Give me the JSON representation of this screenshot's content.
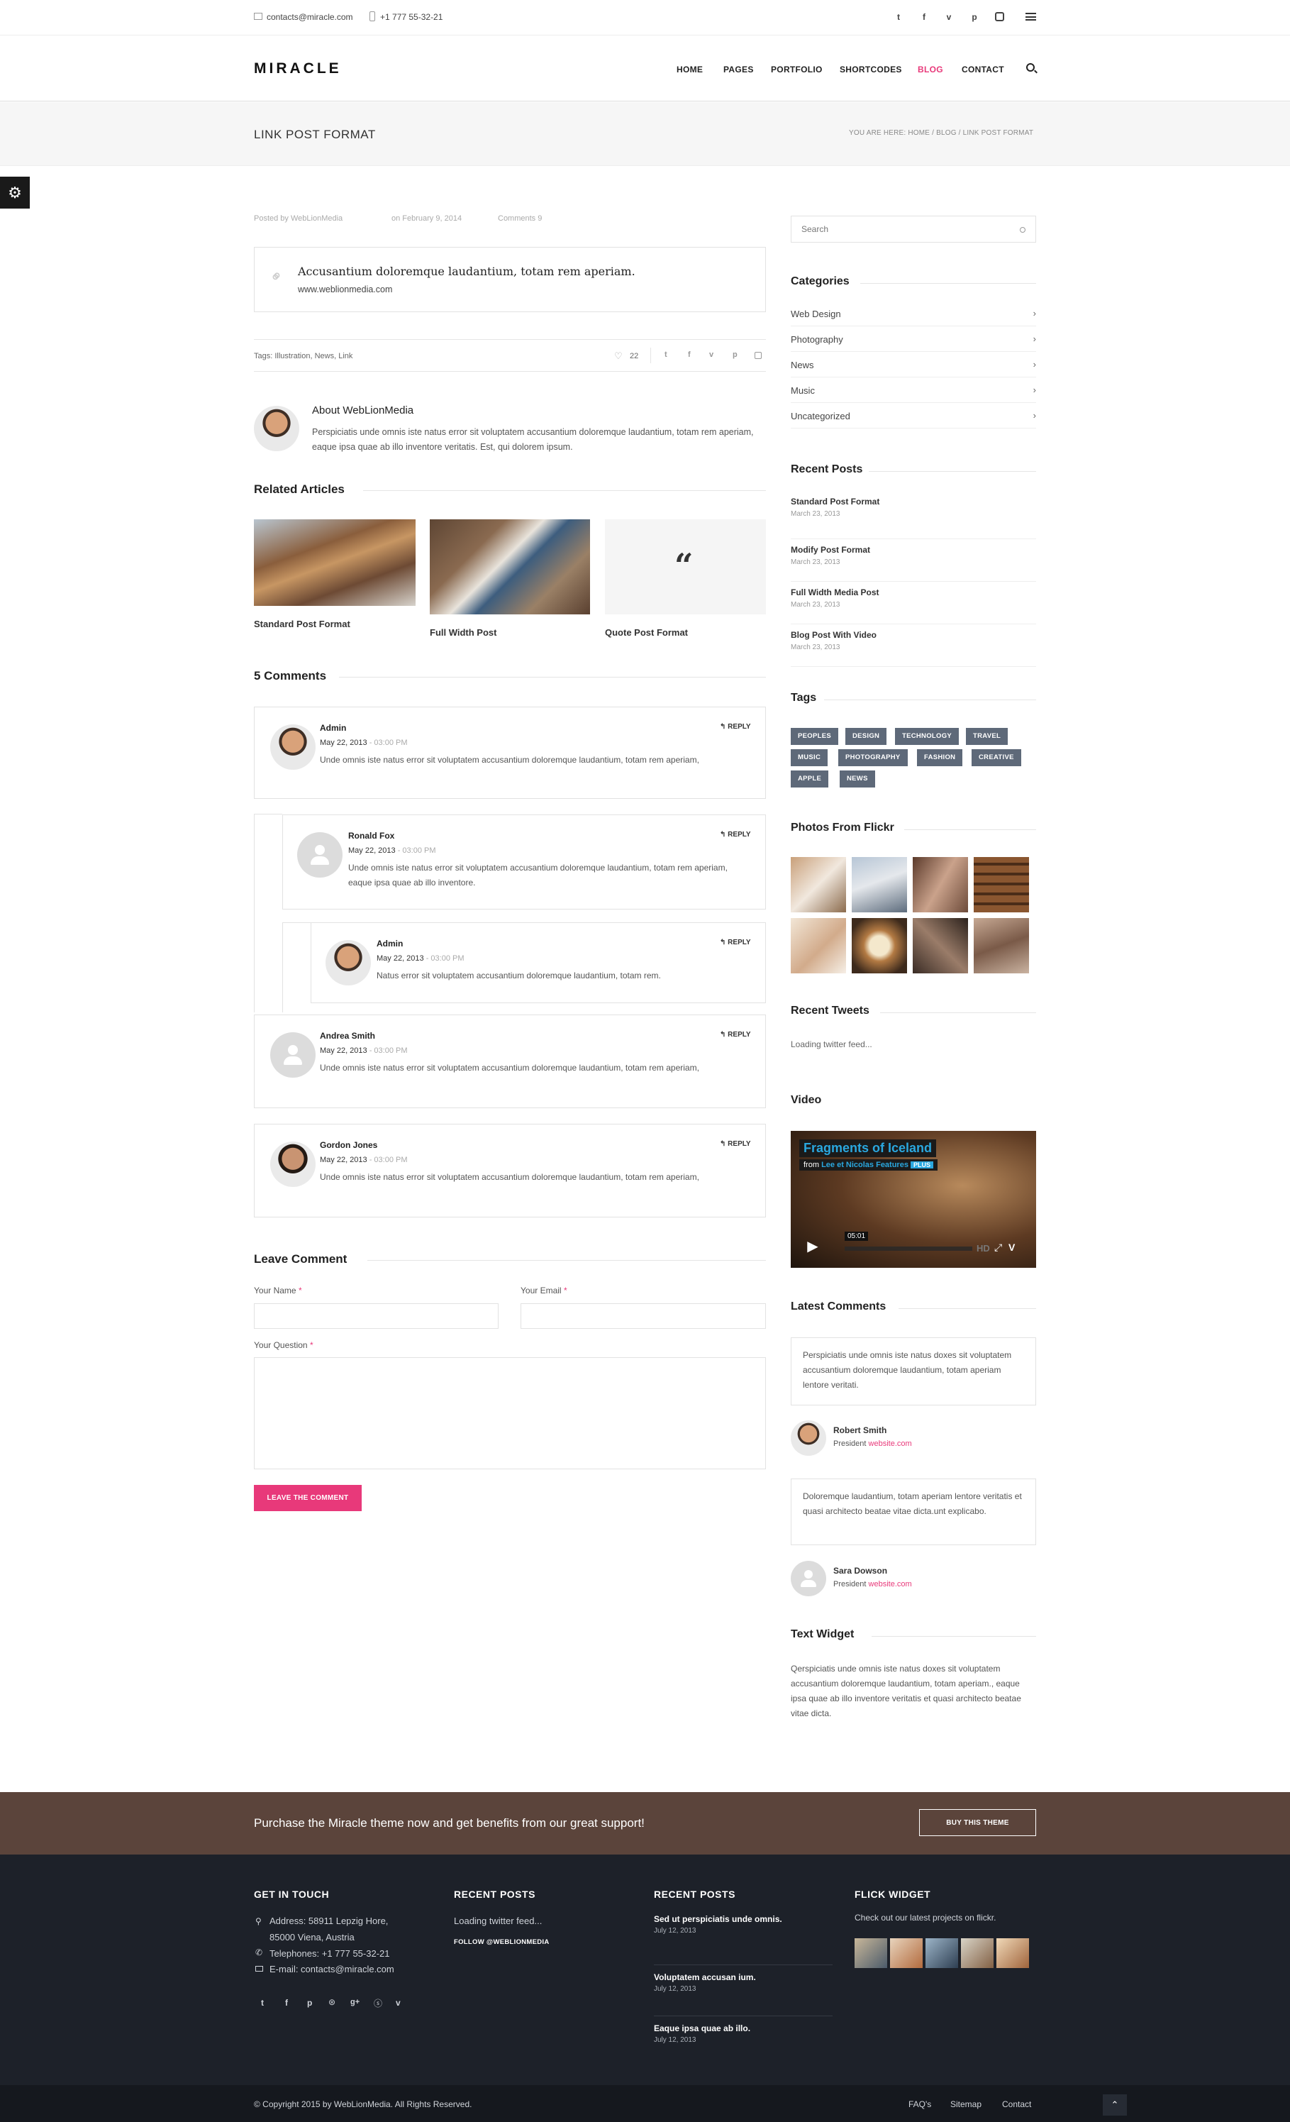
{
  "topbar": {
    "email": "contacts@miracle.com",
    "phone": "+1 777 55-32-21",
    "social": [
      "twitter-icon",
      "facebook-icon",
      "vimeo-icon",
      "pinterest-icon",
      "instagram-icon"
    ]
  },
  "header": {
    "logo": "MIRACLE",
    "nav": [
      "HOME",
      "PAGES",
      "PORTFOLIO",
      "SHORTCODES",
      "BLOG",
      "CONTACT"
    ],
    "active_nav": "BLOG",
    "accent": "#e8397a"
  },
  "titlebar": {
    "title": "LINK POST FORMAT",
    "breadcrumb": "YOU ARE HERE: HOME / BLOG / LINK POST FORMAT"
  },
  "post": {
    "posted_by": "Posted by WebLionMedia",
    "date": "on February 9, 2014",
    "comments": "Comments 9",
    "link_title": "Accusantium doloremque laudantium, totam rem aperiam.",
    "link_url": "www.weblionmedia.com",
    "tags": "Tags: Illustration, News, Link",
    "likes": "22"
  },
  "author": {
    "title": "About WebLionMedia",
    "bio": "Perspiciatis unde omnis iste natus error sit voluptatem accusantium doloremque laudantium, totam rem aperiam, eaque ipsa quae ab illo inventore veritatis. Est, qui dolorem ipsum."
  },
  "related": {
    "title": "Related Articles",
    "items": [
      "Standard Post Format",
      "Full Width Post",
      "Quote Post Format"
    ]
  },
  "comments": {
    "title": "5 Comments",
    "reply_label": "REPLY",
    "list": [
      {
        "name": "Admin",
        "date": "May 22, 2013",
        "time": " - 03:00 PM",
        "text": "Unde omnis iste natus error sit voluptatem accusantium doloremque laudantium, totam rem aperiam,"
      },
      {
        "name": "Ronald Fox",
        "date": "May 22, 2013",
        "time": " - 03:00 PM",
        "text": "Unde omnis iste natus error sit voluptatem accusantium doloremque laudantium, totam rem aperiam, eaque ipsa quae ab illo inventore."
      },
      {
        "name": "Admin",
        "date": "May 22, 2013",
        "time": " - 03:00 PM",
        "text": "Natus error sit voluptatem accusantium doloremque laudantium, totam rem."
      },
      {
        "name": "Andrea Smith",
        "date": "May 22, 2013",
        "time": " - 03:00 PM",
        "text": "Unde omnis iste natus error sit voluptatem accusantium doloremque laudantium, totam rem aperiam,"
      },
      {
        "name": "Gordon Jones",
        "date": "May 22, 2013",
        "time": " - 03:00 PM",
        "text": "Unde omnis iste natus error sit voluptatem accusantium doloremque laudantium, totam rem aperiam,"
      }
    ]
  },
  "form": {
    "title": "Leave Comment",
    "name_label": "Your Name",
    "email_label": "Your Email",
    "question_label": "Your Question",
    "required": "*",
    "submit": "LEAVE THE COMMENT"
  },
  "sidebar": {
    "search_placeholder": "Search",
    "categories_title": "Categories",
    "categories": [
      "Web Design",
      "Photography",
      "News",
      "Music",
      "Uncategorized"
    ],
    "recent_title": "Recent Posts",
    "recent": [
      {
        "title": "Standard Post Format",
        "date": "March 23, 2013"
      },
      {
        "title": "Modify Post Format",
        "date": "March 23, 2013"
      },
      {
        "title": "Full Width Media Post",
        "date": "March 23, 2013"
      },
      {
        "title": "Blog Post With Video",
        "date": "March 23, 2013"
      }
    ],
    "tags_title": "Tags",
    "tags": [
      "PEOPLES",
      "DESIGN",
      "TECHNOLOGY",
      "TRAVEL",
      "MUSIC",
      "PHOTOGRAPHY",
      "FASHION",
      "CREATIVE",
      "APPLE",
      "NEWS"
    ],
    "flickr_title": "Photos From Flickr",
    "tweets_title": "Recent Tweets",
    "tweets_loading": "Loading twitter feed...",
    "video_title": "Video",
    "video": {
      "name": "Fragments of Iceland",
      "from": "from",
      "author": "Lee et Nicolas Features",
      "badge": "PLUS",
      "time": "05:01",
      "hd": "HD"
    },
    "latest_title": "Latest Comments",
    "latest": [
      {
        "text": "Perspiciatis unde omnis iste natus doxes sit voluptatem accusantium doloremque laudantium, totam aperiam lentore veritati.",
        "name": "Robert Smith",
        "role": "President",
        "site": "website.com"
      },
      {
        "text": "Doloremque laudantium, totam aperiam lentore veritatis et quasi architecto beatae vitae dicta.unt explicabo.",
        "name": "Sara Dowson",
        "role": "President",
        "site": "website.com"
      }
    ],
    "text_title": "Text Widget",
    "text_body": "Qerspiciatis unde omnis iste natus doxes sit voluptatem accusantium doloremque laudantium, totam aperiam., eaque ipsa quae ab illo inventore veritatis et quasi architecto beatae vitae dicta."
  },
  "cta": {
    "text": "Purchase the Miracle theme now and get benefits from our great support!",
    "button": "BUY THIS THEME",
    "bg": "#5b443b"
  },
  "footer": {
    "touch_title": "GET IN TOUCH",
    "address1": "Address: 58911 Lepzig Hore,",
    "address2": "85000 Viena, Austria",
    "phone": "Telephones: +1 777 55-32-21",
    "email": "E-mail: contacts@miracle.com",
    "recent1_title": "RECENT POSTS",
    "loading": "Loading twitter feed...",
    "follow": "FOLLOW @WEBLIONMEDIA",
    "recent2_title": "RECENT POSTS",
    "posts": [
      {
        "title": "Sed ut perspiciatis unde omnis.",
        "date": "July 12, 2013"
      },
      {
        "title": "Voluptatem accusan ium.",
        "date": "July 12, 2013"
      },
      {
        "title": "Eaque ipsa quae ab illo.",
        "date": "July 12, 2013"
      }
    ],
    "flick_title": "FLICK WIDGET",
    "flick_text": "Check out our latest projects on flickr.",
    "copyright": "© Copyright 2015 by WebLionMedia. All Rights Reserved.",
    "links": [
      "FAQ's",
      "Sitemap",
      "Contact"
    ],
    "bg": "#1d2129"
  }
}
